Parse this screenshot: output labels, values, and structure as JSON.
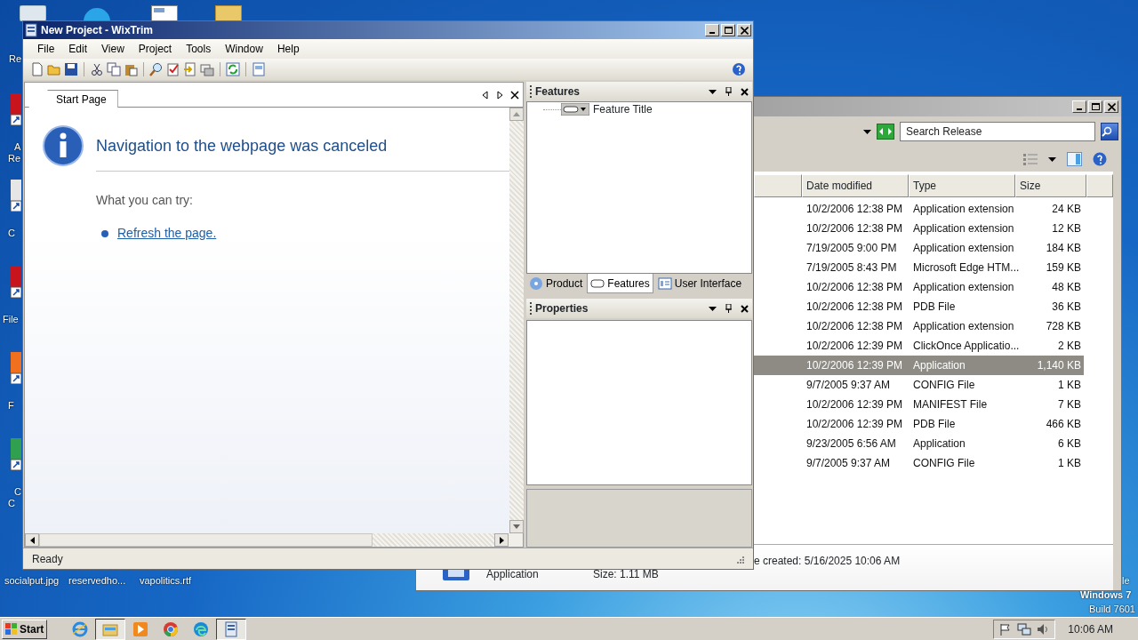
{
  "desktop": {
    "top_icons": [
      {
        "kind": "trash"
      },
      {
        "kind": "app"
      },
      {
        "kind": "document"
      },
      {
        "kind": "folder"
      }
    ],
    "left_icons": [
      {
        "kind": "red",
        "lines": [
          "A",
          "Re"
        ]
      },
      {
        "kind": "white",
        "lines": [
          "C"
        ]
      },
      {
        "kind": "red",
        "lines": [
          "File"
        ]
      },
      {
        "kind": "orange",
        "lines": [
          "F"
        ]
      },
      {
        "kind": "green",
        "lines": [
          "C",
          "C"
        ]
      }
    ],
    "top_label": "Re",
    "bottom_labels": [
      "socialput.jpg",
      "reservedho...",
      "vapolitics.rtf"
    ],
    "os_notice": [
      "le",
      "Windows 7",
      "Build 7601"
    ]
  },
  "main_window": {
    "title": "New Project - WixTrim",
    "menu": [
      "File",
      "Edit",
      "View",
      "Project",
      "Tools",
      "Window",
      "Help"
    ],
    "toolbar": [
      {
        "items": [
          {
            "kind": "new"
          },
          {
            "kind": "open"
          },
          {
            "kind": "save"
          }
        ]
      },
      {
        "items": [
          {
            "kind": "cut"
          },
          {
            "kind": "copy"
          },
          {
            "kind": "paste"
          }
        ]
      },
      {
        "items": [
          {
            "kind": "find"
          },
          {
            "kind": "validate"
          },
          {
            "kind": "build"
          },
          {
            "kind": "build-all"
          }
        ]
      },
      {
        "items": [
          {
            "kind": "refresh"
          }
        ]
      },
      {
        "items": [
          {
            "kind": "export"
          }
        ]
      }
    ],
    "document_tabs": [
      {
        "label": "Start Page",
        "selected": true
      }
    ],
    "page": {
      "heading": "Navigation to the webpage was canceled",
      "prompt": "What you can try:",
      "suggestions": [
        "Refresh the page."
      ]
    },
    "features_pane": {
      "title": "Features",
      "tree": [
        {
          "label": "Feature Title"
        }
      ]
    },
    "pane_tabs": [
      {
        "label": "Product",
        "kind": "product",
        "selected": false
      },
      {
        "label": "Features",
        "kind": "features",
        "selected": true
      },
      {
        "label": "User Interface",
        "kind": "ui",
        "selected": false
      }
    ],
    "properties_pane": {
      "title": "Properties"
    },
    "status": "Ready"
  },
  "explorer": {
    "search": {
      "placeholder": "Search Release"
    },
    "columns": [
      "Date modified",
      "Type",
      "Size"
    ],
    "rows": [
      {
        "date": "10/2/2006 12:38 PM",
        "type": "Application extension",
        "size": "24 KB",
        "selected": false
      },
      {
        "date": "10/2/2006 12:38 PM",
        "type": "Application extension",
        "size": "12 KB",
        "selected": false
      },
      {
        "date": "7/19/2005 9:00 PM",
        "type": "Application extension",
        "size": "184 KB",
        "selected": false
      },
      {
        "date": "7/19/2005 8:43 PM",
        "type": "Microsoft Edge HTM...",
        "size": "159 KB",
        "selected": false
      },
      {
        "date": "10/2/2006 12:38 PM",
        "type": "Application extension",
        "size": "48 KB",
        "selected": false
      },
      {
        "date": "10/2/2006 12:38 PM",
        "type": "PDB File",
        "size": "36 KB",
        "selected": false
      },
      {
        "date": "10/2/2006 12:38 PM",
        "type": "Application extension",
        "size": "728 KB",
        "selected": false
      },
      {
        "date": "10/2/2006 12:39 PM",
        "type": "ClickOnce Applicatio...",
        "size": "2 KB",
        "selected": false
      },
      {
        "date": "10/2/2006 12:39 PM",
        "type": "Application",
        "size": "1,140 KB",
        "selected": true
      },
      {
        "date": "9/7/2005 9:37 AM",
        "type": "CONFIG File",
        "size": "1 KB",
        "selected": false
      },
      {
        "date": "10/2/2006 12:39 PM",
        "type": "MANIFEST File",
        "size": "7 KB",
        "selected": false
      },
      {
        "date": "10/2/2006 12:39 PM",
        "type": "PDB File",
        "size": "466 KB",
        "selected": false
      },
      {
        "date": "9/23/2005 6:56 AM",
        "type": "Application",
        "size": "6 KB",
        "selected": false
      },
      {
        "date": "9/7/2005 9:37 AM",
        "type": "CONFIG File",
        "size": "1 KB",
        "selected": false
      }
    ],
    "details": {
      "created": "e created: 5/16/2025 10:06 AM",
      "type": "Application",
      "size": "Size: 1.11 MB"
    }
  },
  "taskbar": {
    "start": "Start",
    "apps": [
      {
        "kind": "ie",
        "selected": false
      },
      {
        "kind": "explorer",
        "selected": true
      },
      {
        "kind": "media",
        "selected": false
      },
      {
        "kind": "chrome",
        "selected": false
      },
      {
        "kind": "edge",
        "selected": false
      },
      {
        "kind": "wixtrim",
        "selected": true
      }
    ],
    "clock": "10:06 AM"
  }
}
